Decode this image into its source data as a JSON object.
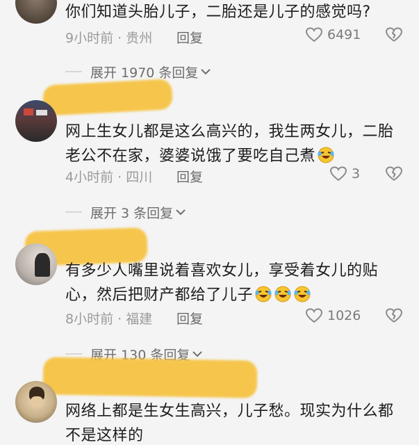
{
  "comments": [
    {
      "text": "你们知道头胎儿子，二胎还是儿子的感觉吗?",
      "time": "9小时前 · 贵州",
      "reply": "回复",
      "likes": "6491"
    },
    {
      "text": "网上生女儿都是这么高兴的，我生两女儿，二胎老公不在家，婆婆说饿了要吃自己煮",
      "time": "4小时前 · 四川",
      "reply": "回复",
      "likes": "3"
    },
    {
      "text": "有多少人嘴里说着喜欢女儿，享受着女儿的贴心，然后把财产都给了儿子",
      "time": "8小时前 · 福建",
      "reply": "回复",
      "likes": "1026"
    },
    {
      "text": "网络上都是生女生高兴，儿子愁。现实为什么都不是这样的"
    }
  ],
  "expand_replies": [
    {
      "label": "展开 1970 条回复"
    },
    {
      "label": "展开 3 条回复"
    },
    {
      "label": "展开 130 条回复"
    }
  ],
  "icons": {
    "heart": "heart-outline-icon",
    "broken_heart": "broken-heart-icon",
    "chevron": "chevron-down-icon",
    "emoji": "laughing-crying-emoji"
  },
  "colors": {
    "background": "#f4f4f4",
    "censor_smear": "#f6c23e",
    "meta_text": "#9a9a9a"
  }
}
